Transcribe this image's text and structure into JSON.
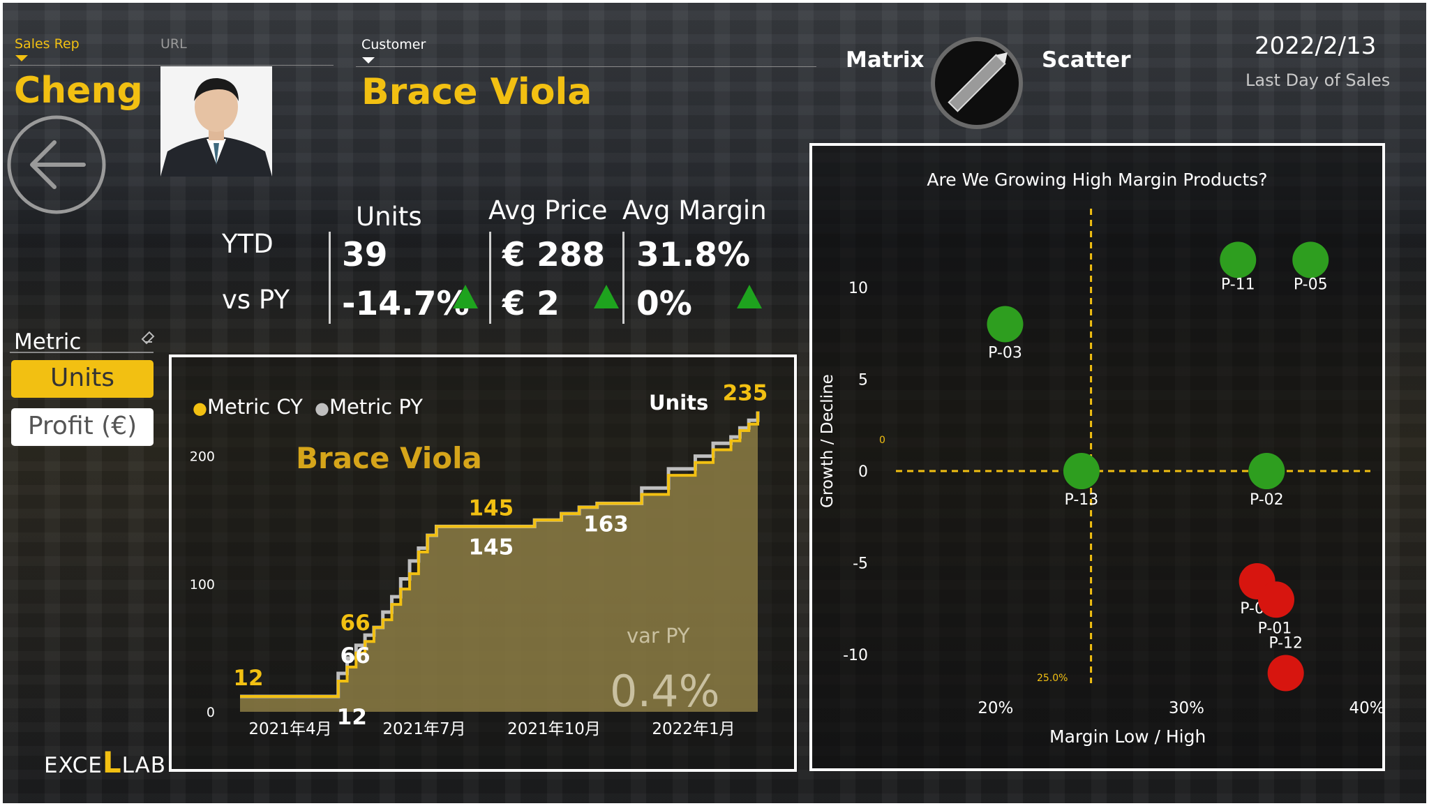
{
  "filters": {
    "sales_rep_label": "Sales Rep",
    "url_label": "URL",
    "sales_rep_value": "Cheng",
    "customer_label": "Customer",
    "customer_value": "Brace Viola"
  },
  "toggle": {
    "left_label": "Matrix",
    "right_label": "Scatter"
  },
  "date": {
    "value": "2022/2/13",
    "caption": "Last Day of Sales"
  },
  "kpis": {
    "row_ytd": "YTD",
    "row_vspy": "vs PY",
    "columns": [
      {
        "header": "Units",
        "ytd": "39",
        "vs_py": "-14.7%"
      },
      {
        "header": "Avg Price",
        "ytd": "€ 288",
        "vs_py": "€ 2"
      },
      {
        "header": "Avg Margin",
        "ytd": "31.8%",
        "vs_py": "0%"
      }
    ]
  },
  "metric_slicer": {
    "title": "Metric",
    "options": [
      "Units",
      "Profit (€)"
    ],
    "selected": "Units"
  },
  "brand": {
    "left": "EXCE",
    "mid": "L",
    "right": "LAB"
  },
  "line_panel": {
    "legend_cy": "Metric CY",
    "legend_py": "Metric PY",
    "metric_title": "Units",
    "customer_title": "Brace Viola",
    "var_label": "var PY",
    "var_value": "0.4%",
    "colors": {
      "cy": "#f2c012",
      "py": "#bfbfbf",
      "area": "#8c7c44"
    }
  },
  "scatter_panel": {
    "title": "Are We Growing High Margin Products?",
    "xlabel": "Margin Low / High",
    "ylabel": "Growth / Decline",
    "ref_x_label": "25.0%",
    "ref_y_label": "0"
  },
  "chart_data": [
    {
      "type": "line",
      "title": "Units",
      "x_tick_labels": [
        "2021年4月",
        "2021年7月",
        "2021年10月",
        "2022年1月"
      ],
      "y_ticks": [
        0,
        100,
        200
      ],
      "ylim": [
        0,
        250
      ],
      "series": [
        {
          "name": "Metric CY",
          "color": "#f2c012",
          "values": [
            12,
            12,
            12,
            12,
            12,
            12,
            12,
            12,
            12,
            12,
            12,
            24,
            35,
            46,
            55,
            66,
            72,
            84,
            96,
            108,
            125,
            138,
            145,
            145,
            145,
            145,
            145,
            145,
            145,
            145,
            145,
            145,
            145,
            150,
            150,
            150,
            155,
            155,
            160,
            160,
            163,
            163,
            163,
            163,
            163,
            170,
            170,
            170,
            185,
            185,
            185,
            195,
            195,
            205,
            205,
            212,
            220,
            225,
            235
          ]
        },
        {
          "name": "Metric PY",
          "color": "#bfbfbf",
          "values": [
            12,
            12,
            12,
            12,
            12,
            12,
            12,
            12,
            12,
            12,
            12,
            30,
            42,
            52,
            60,
            66,
            78,
            90,
            104,
            118,
            128,
            138,
            145,
            145,
            145,
            145,
            145,
            145,
            145,
            145,
            145,
            145,
            145,
            150,
            150,
            150,
            155,
            155,
            160,
            160,
            163,
            163,
            163,
            163,
            163,
            175,
            175,
            175,
            190,
            190,
            190,
            200,
            200,
            210,
            210,
            215,
            222,
            228,
            235
          ]
        }
      ],
      "data_labels": [
        {
          "text": "12",
          "series": "Metric CY"
        },
        {
          "text": "12",
          "series": "Metric PY"
        },
        {
          "text": "66",
          "series": "Metric CY"
        },
        {
          "text": "66",
          "series": "Metric PY"
        },
        {
          "text": "145",
          "series": "Metric CY"
        },
        {
          "text": "145",
          "series": "Metric PY"
        },
        {
          "text": "163",
          "series": "Metric PY"
        },
        {
          "text": "235",
          "series": "Metric CY"
        }
      ]
    },
    {
      "type": "scatter",
      "title": "Are We Growing High Margin Products?",
      "xlabel": "Margin Low / High",
      "ylabel": "Growth / Decline",
      "x_ticks": [
        "20%",
        "30%",
        "40%"
      ],
      "y_ticks": [
        10,
        5,
        0,
        -5,
        -10
      ],
      "xlim": [
        0.15,
        0.4
      ],
      "ylim": [
        -12.5,
        12.2
      ],
      "reference_lines": {
        "x": 0.25,
        "y": 0
      },
      "points": [
        {
          "label": "P-11",
          "x": 0.327,
          "y": 11.5,
          "color": "#2e9e1f"
        },
        {
          "label": "P-05",
          "x": 0.365,
          "y": 11.5,
          "color": "#2e9e1f"
        },
        {
          "label": "P-03",
          "x": 0.205,
          "y": 8.0,
          "color": "#2e9e1f"
        },
        {
          "label": "P-13",
          "x": 0.245,
          "y": 0,
          "color": "#2e9e1f"
        },
        {
          "label": "P-02",
          "x": 0.342,
          "y": 0,
          "color": "#2e9e1f"
        },
        {
          "label": "P-07",
          "x": 0.337,
          "y": -6.0,
          "color": "#d7150f"
        },
        {
          "label": "P-01",
          "x": 0.347,
          "y": -7.0,
          "color": "#d7150f"
        },
        {
          "label": "P-12",
          "x": 0.352,
          "y": -11.0,
          "color": "#d7150f"
        }
      ]
    }
  ]
}
